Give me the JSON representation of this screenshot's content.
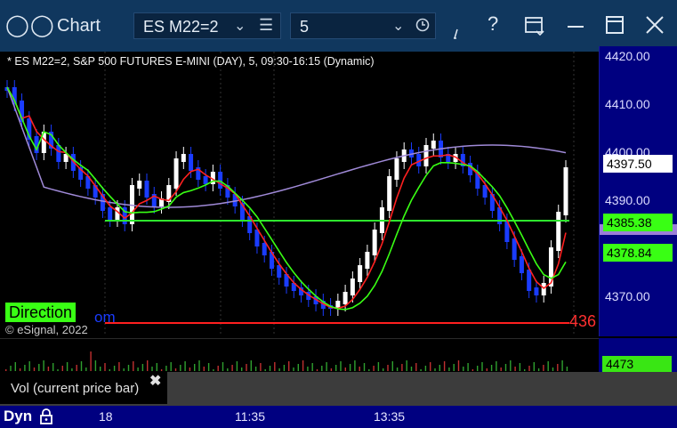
{
  "window": {
    "title": "Chart",
    "symbol": "ES M22=2",
    "interval": "5",
    "icons": [
      "logo-icon",
      "chevron-down-icon",
      "menu-icon",
      "clock-icon",
      "draw-icon",
      "help-icon",
      "layout-icon",
      "minimize-icon",
      "maximize-icon",
      "close-icon"
    ]
  },
  "chart": {
    "description": "* ES M22=2, S&P 500 FUTURES E-MINI (DAY), 5, 09:30-16:15 (Dynamic)",
    "direction_label": "Direction",
    "watermark_text": "om",
    "copyright": "© eSignal, 2022",
    "right_edge_label": "436",
    "price_axis": {
      "labels": [
        "4420.00",
        "4410.00",
        "4400.00",
        "4390.00",
        "4370.00"
      ],
      "tags": [
        {
          "text": "4397.50",
          "bg": "#ffffff",
          "fg": "#000000"
        },
        {
          "text": "4385.38",
          "bg": "#39ff14",
          "fg": "#000000"
        },
        {
          "text": "4378.84",
          "bg": "#39ff14",
          "fg": "#000000"
        }
      ]
    },
    "colors": {
      "bull": "#ffffff",
      "bear": "#1a3cff",
      "ma_fast": "#39ff14",
      "ma_mid": "#ff2020",
      "ma_slow": "#a08ad8",
      "flat_green": "#2ee62e",
      "flat_red": "#ff2020"
    }
  },
  "volume": {
    "label": "Vol (current price bar)",
    "close_glyph": "✖",
    "value": "4473"
  },
  "time_axis": {
    "mode": "Dyn",
    "labels": [
      "18",
      "11:35",
      "13:35"
    ]
  }
}
